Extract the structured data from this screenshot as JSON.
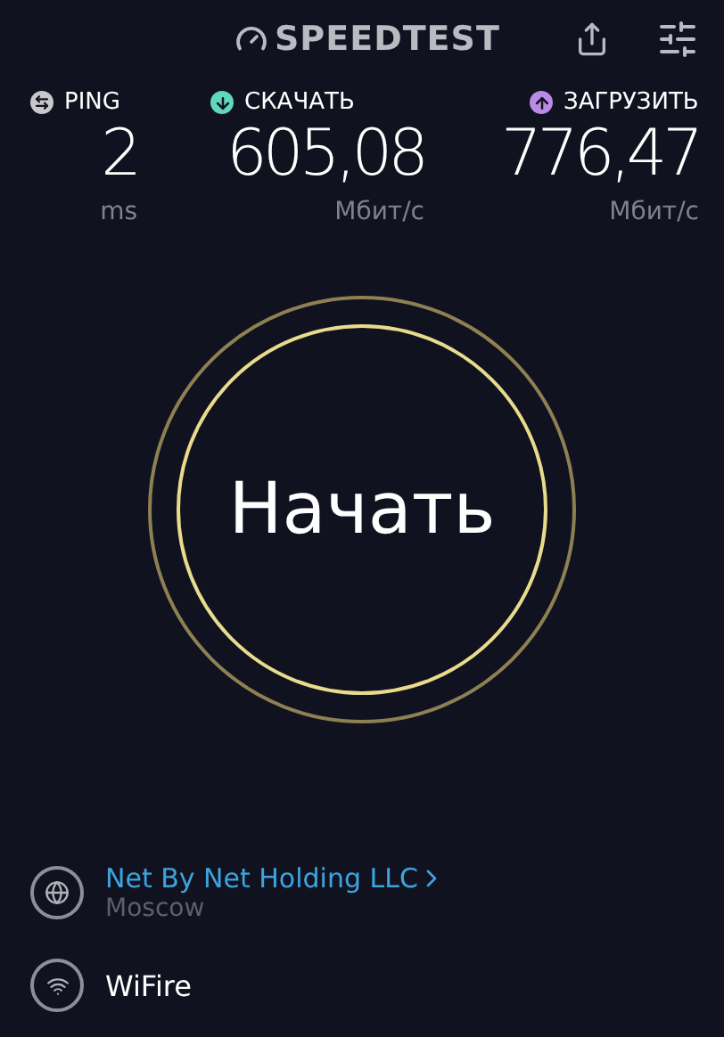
{
  "header": {
    "logo": "SPEEDTEST"
  },
  "metrics": [
    {
      "kind": "ping",
      "label": "PING",
      "value": "2",
      "unit": "ms",
      "color": "#c8c8cc"
    },
    {
      "kind": "download",
      "label": "СКАЧАТЬ",
      "value": "605,08",
      "unit": "Мбит/с",
      "color": "#5fd9b9"
    },
    {
      "kind": "upload",
      "label": "ЗАГРУЗИТЬ",
      "value": "776,47",
      "unit": "Мбит/с",
      "color": "#b98be6"
    }
  ],
  "start_button": {
    "label": "Начать"
  },
  "provider": {
    "name": "Net By Net Holding LLC",
    "location": "Moscow"
  },
  "network": {
    "name": "WiFire"
  }
}
